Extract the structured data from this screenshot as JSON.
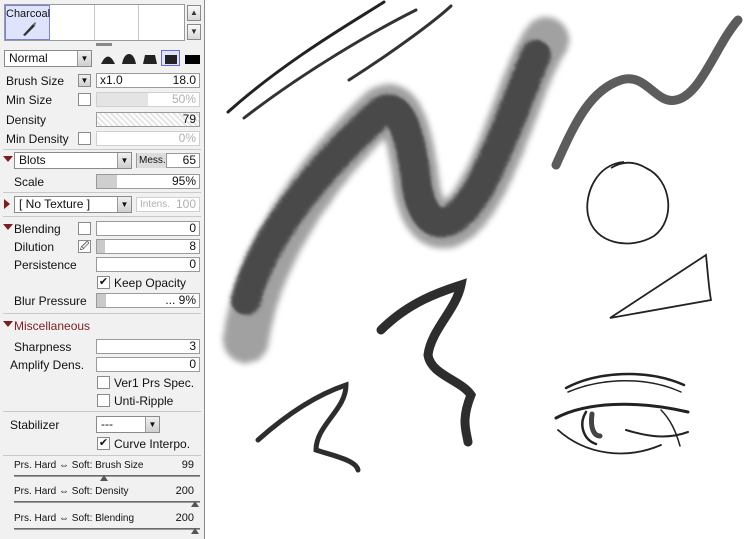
{
  "brush_tray": {
    "selected_label": "Charcoal"
  },
  "blend_mode": "Normal",
  "brush_size": {
    "label": "Brush Size",
    "multiplier": "x1.0",
    "value": "18.0"
  },
  "min_size": {
    "label": "Min Size",
    "value": "50%",
    "percent": 50
  },
  "density": {
    "label": "Density",
    "value": "79",
    "percent": 79
  },
  "min_density": {
    "label": "Min Density",
    "value": "0%",
    "percent": 0
  },
  "shape": {
    "name": "Blots",
    "mess_label": "Mess.",
    "mess_value": "65",
    "scale_label": "Scale",
    "scale_value": "95%",
    "scale_percent": 95
  },
  "texture": {
    "name": "[ No Texture ]",
    "intens_label": "Intens.",
    "intens_value": "100"
  },
  "blending": {
    "label": "Blending",
    "value": "0",
    "percent": 0,
    "dilution_label": "Dilution",
    "dilution_value": "8",
    "dilution_percent": 8,
    "persistence_label": "Persistence",
    "persistence_value": "0",
    "persistence_percent": 0,
    "keep_opacity_label": "Keep Opacity",
    "keep_opacity_checked": true,
    "blur_pressure_label": "Blur Pressure",
    "blur_pressure_value": "... 9%",
    "blur_percent": 9
  },
  "misc": {
    "label": "Miscellaneous",
    "sharpness_label": "Sharpness",
    "sharpness_value": "3",
    "amplify_label": "Amplify Dens.",
    "amplify_value": "0",
    "ver1_label": "Ver1 Prs Spec.",
    "unti_ripple_label": "Unti-Ripple"
  },
  "stabilizer": {
    "label": "Stabilizer",
    "value": "---",
    "curve_interpo_label": "Curve Interpo.",
    "curve_interpo_checked": true
  },
  "pressure": [
    {
      "label": "Prs. Hard ⇔ Soft: Brush Size",
      "value": "99"
    },
    {
      "label": "Prs. Hard ⇔ Soft: Density",
      "value": "200"
    },
    {
      "label": "Prs. Hard ⇔ Soft: Blending",
      "value": "200"
    }
  ],
  "colors": {
    "section_arrow": "#7a1f1f",
    "selected_tool": "#dfe3fb",
    "panel_bg": "#f1f1f1"
  }
}
